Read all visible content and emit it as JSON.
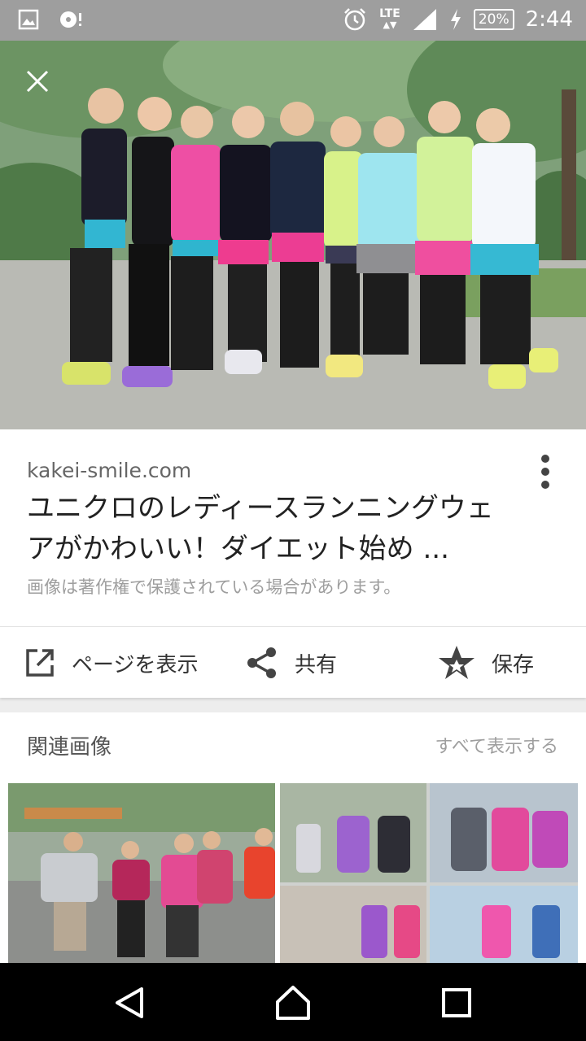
{
  "status_bar": {
    "time": "2:44",
    "battery": "20%",
    "network": "LTE",
    "icons": [
      "image-icon",
      "media-icon",
      "alarm-icon",
      "signal-icon",
      "charging-icon"
    ]
  },
  "result": {
    "domain": "kakei-smile.com",
    "title": "ユニクロのレディースランニングウェアがかわいい！ダイエット始め ...",
    "copyright_note": "画像は著作権で保護されている場合があります。"
  },
  "actions": {
    "visit_label": "ページを表示",
    "share_label": "共有",
    "save_label": "保存"
  },
  "related": {
    "title": "関連画像",
    "see_all": "すべて表示する"
  },
  "colors": {
    "status_bar": "#9e9e9e",
    "card": "#ffffff",
    "background": "#ededed",
    "nav_bar": "#000000"
  }
}
